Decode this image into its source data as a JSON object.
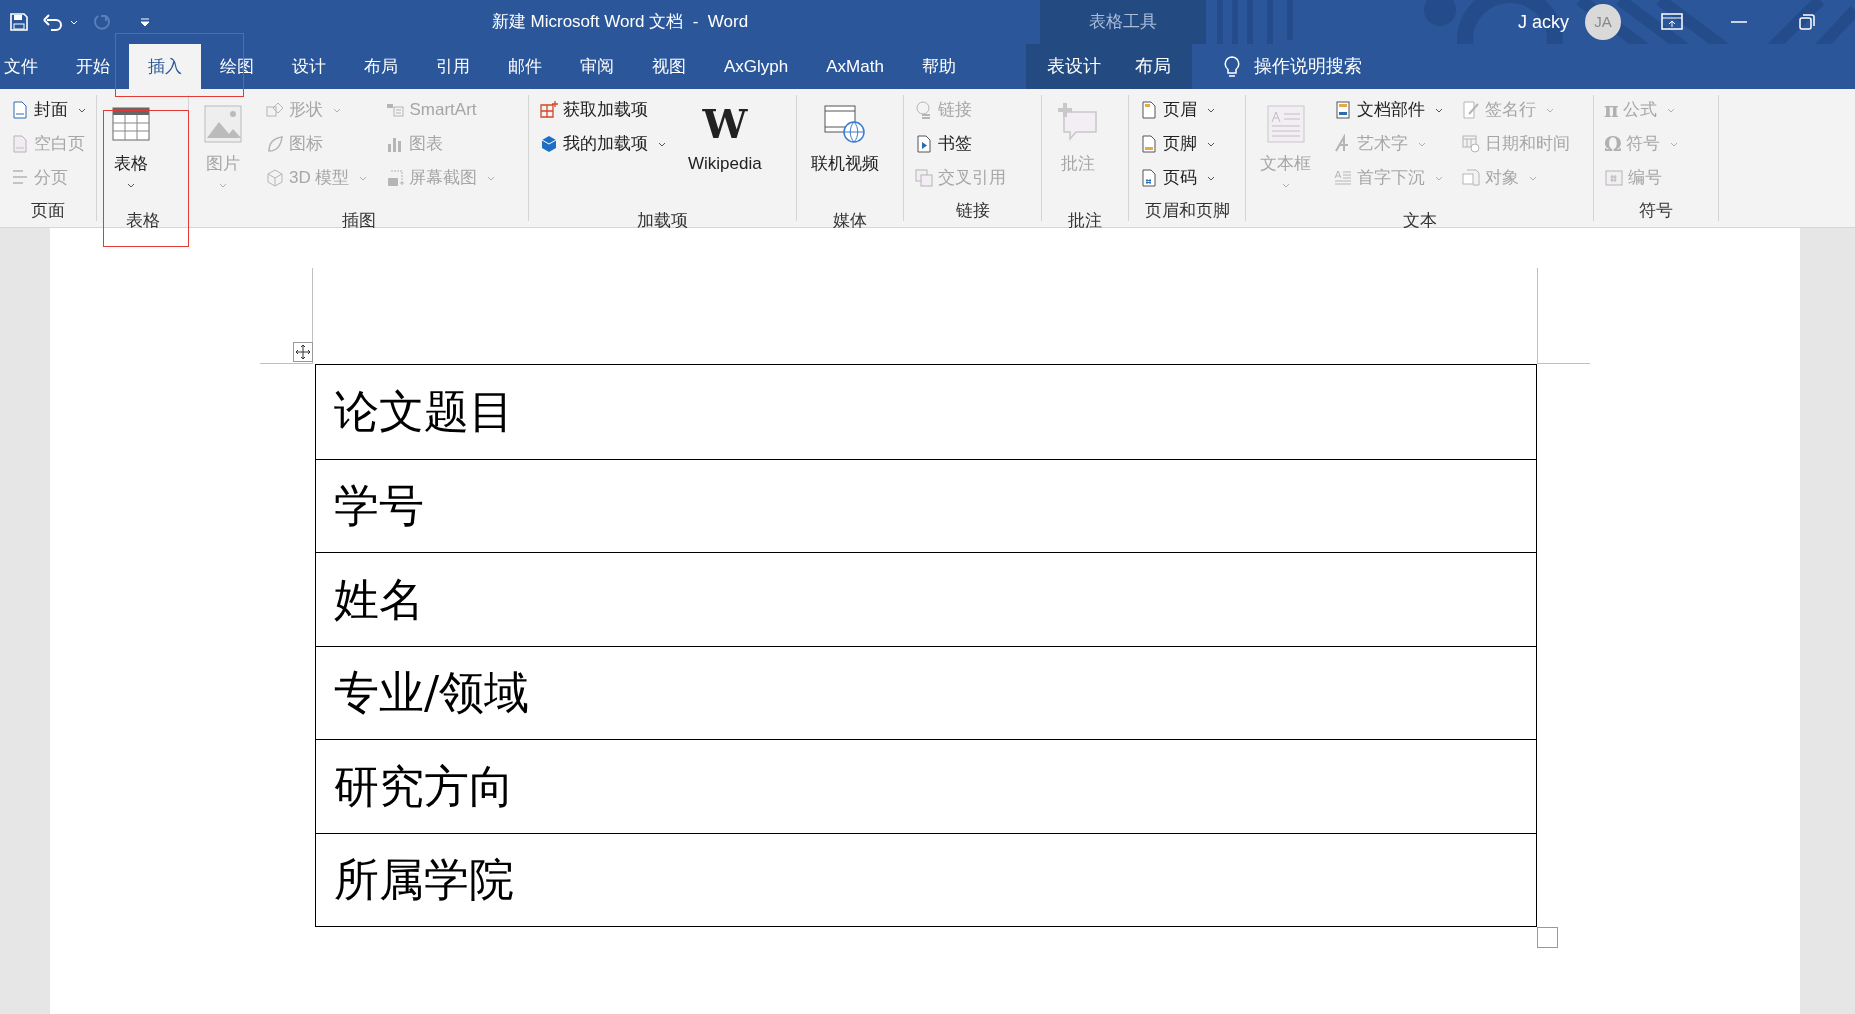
{
  "title_bar": {
    "title": "新建 Microsoft Word 文档  -  Word",
    "context_label": "表格工具",
    "user_name": "J acky",
    "avatar_initials": "JA"
  },
  "tabs": [
    {
      "label": "文件",
      "selected": false
    },
    {
      "label": "开始",
      "selected": false
    },
    {
      "label": "插入",
      "selected": true
    },
    {
      "label": "绘图",
      "selected": false
    },
    {
      "label": "设计",
      "selected": false
    },
    {
      "label": "布局",
      "selected": false
    },
    {
      "label": "引用",
      "selected": false
    },
    {
      "label": "邮件",
      "selected": false
    },
    {
      "label": "审阅",
      "selected": false
    },
    {
      "label": "视图",
      "selected": false
    },
    {
      "label": "AxGlyph",
      "selected": false
    },
    {
      "label": "AxMath",
      "selected": false
    },
    {
      "label": "帮助",
      "selected": false
    }
  ],
  "context_tabs": [
    {
      "label": "表设计",
      "selected": false
    },
    {
      "label": "布局",
      "selected": false
    }
  ],
  "tell_me": {
    "label": "操作说明搜索"
  },
  "ribbon_groups": [
    {
      "label": "页面",
      "columns": [
        [
          {
            "label": "封面",
            "kind": "small",
            "disabled": false,
            "dropdown": true
          },
          {
            "label": "空白页",
            "kind": "small",
            "disabled": true,
            "dropdown": false
          },
          {
            "label": "分页",
            "kind": "small",
            "disabled": true,
            "dropdown": false
          }
        ]
      ]
    },
    {
      "label": "表格",
      "columns": [
        [
          {
            "label": "表格",
            "kind": "large",
            "disabled": false,
            "dropdown": true
          }
        ]
      ]
    },
    {
      "label": "插图",
      "columns": [
        [
          {
            "label": "图片",
            "kind": "large",
            "disabled": true,
            "dropdown": true
          }
        ],
        [
          {
            "label": "形状",
            "kind": "small",
            "disabled": true,
            "dropdown": true
          },
          {
            "label": "图标",
            "kind": "small",
            "disabled": true,
            "dropdown": false
          },
          {
            "label": "3D 模型",
            "kind": "small",
            "disabled": true,
            "dropdown": true
          }
        ],
        [
          {
            "label": "SmartArt",
            "kind": "small",
            "disabled": true,
            "dropdown": false
          },
          {
            "label": "图表",
            "kind": "small",
            "disabled": true,
            "dropdown": false
          },
          {
            "label": "屏幕截图",
            "kind": "small",
            "disabled": true,
            "dropdown": true
          }
        ]
      ]
    },
    {
      "label": "加载项",
      "columns": [
        [
          {
            "label": "获取加载项",
            "kind": "small",
            "disabled": false,
            "dropdown": false
          },
          {
            "label": "我的加载项",
            "kind": "small",
            "disabled": false,
            "dropdown": true
          }
        ],
        [
          {
            "label": "Wikipedia",
            "kind": "large",
            "disabled": false,
            "dropdown": false,
            "glyph": "W"
          }
        ]
      ]
    },
    {
      "label": "媒体",
      "columns": [
        [
          {
            "label": "联机视频",
            "kind": "large",
            "disabled": false,
            "dropdown": false
          }
        ]
      ]
    },
    {
      "label": "链接",
      "columns": [
        [
          {
            "label": "链接",
            "kind": "small",
            "disabled": true,
            "dropdown": false
          },
          {
            "label": "书签",
            "kind": "small",
            "disabled": false,
            "dropdown": false
          },
          {
            "label": "交叉引用",
            "kind": "small",
            "disabled": true,
            "dropdown": false
          }
        ]
      ]
    },
    {
      "label": "批注",
      "columns": [
        [
          {
            "label": "批注",
            "kind": "large",
            "disabled": true,
            "dropdown": false
          }
        ]
      ]
    },
    {
      "label": "页眉和页脚",
      "columns": [
        [
          {
            "label": "页眉",
            "kind": "small",
            "disabled": false,
            "dropdown": true
          },
          {
            "label": "页脚",
            "kind": "small",
            "disabled": false,
            "dropdown": true
          },
          {
            "label": "页码",
            "kind": "small",
            "disabled": false,
            "dropdown": true
          }
        ]
      ]
    },
    {
      "label": "文本",
      "columns": [
        [
          {
            "label": "文本框",
            "kind": "large",
            "disabled": true,
            "dropdown": true
          }
        ],
        [
          {
            "label": "文档部件",
            "kind": "small",
            "disabled": false,
            "dropdown": true
          },
          {
            "label": "艺术字",
            "kind": "small",
            "disabled": true,
            "dropdown": true
          },
          {
            "label": "首字下沉",
            "kind": "small",
            "disabled": true,
            "dropdown": true
          }
        ],
        [
          {
            "label": "签名行",
            "kind": "small",
            "disabled": true,
            "dropdown": true
          },
          {
            "label": "日期和时间",
            "kind": "small",
            "disabled": true,
            "dropdown": false
          },
          {
            "label": "对象",
            "kind": "small",
            "disabled": true,
            "dropdown": true
          }
        ]
      ]
    },
    {
      "label": "符号",
      "columns": [
        [
          {
            "label": "公式",
            "kind": "small",
            "disabled": true,
            "dropdown": true,
            "glyph": "π"
          },
          {
            "label": "符号",
            "kind": "small",
            "disabled": true,
            "dropdown": true,
            "glyph": "Ω"
          },
          {
            "label": "编号",
            "kind": "small",
            "disabled": true,
            "dropdown": false
          }
        ]
      ]
    }
  ],
  "document": {
    "table_rows": [
      {
        "text": "论文题目"
      },
      {
        "text": "学号"
      },
      {
        "text": "姓名"
      },
      {
        "text": "专业/领域"
      },
      {
        "text": "研究方向"
      },
      {
        "text": "所属学院"
      }
    ]
  }
}
